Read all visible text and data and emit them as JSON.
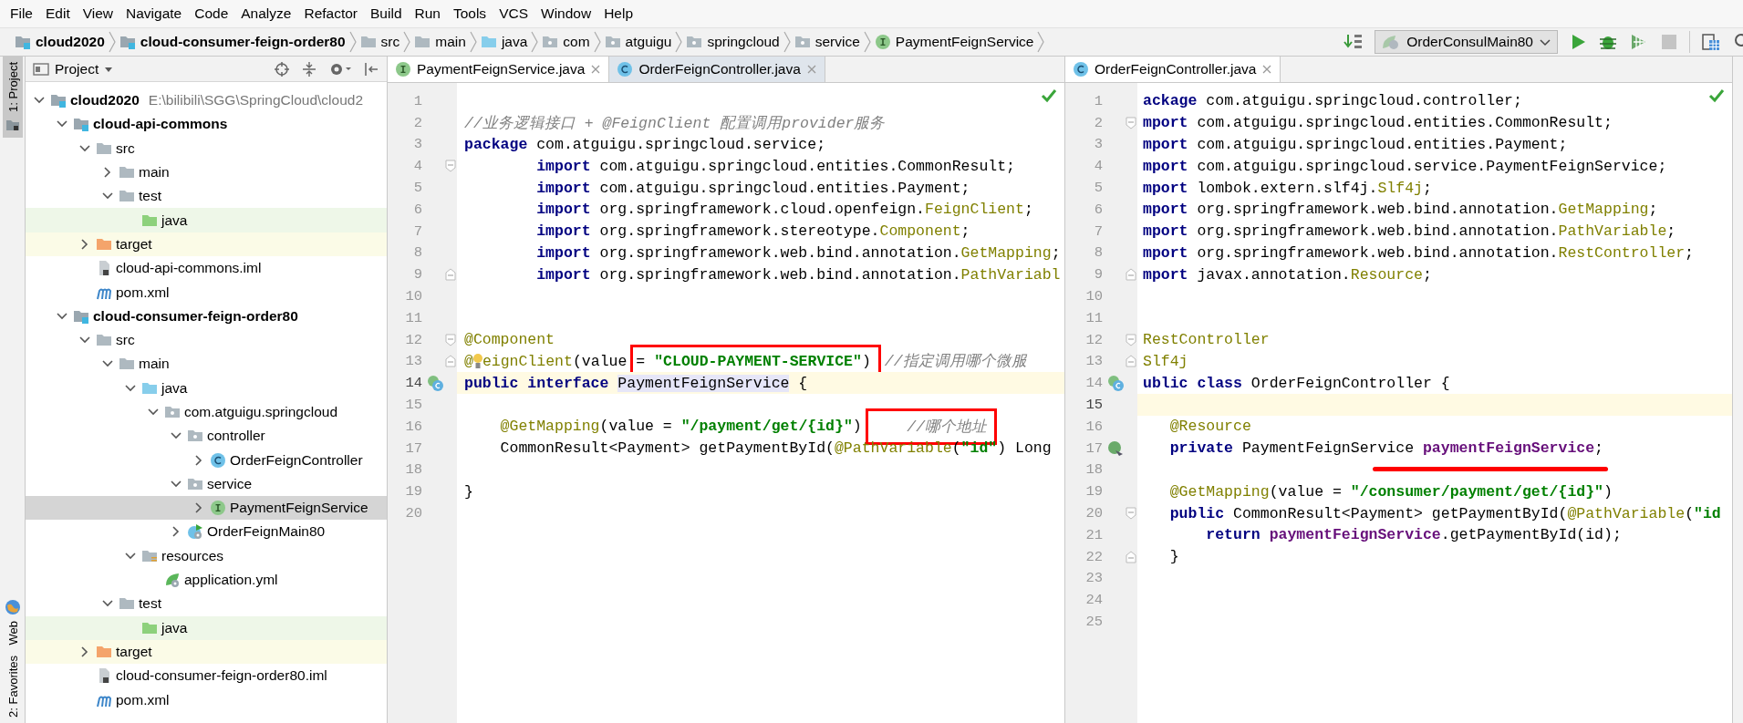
{
  "menu": [
    {
      "label": "File"
    },
    {
      "label": "Edit"
    },
    {
      "label": "View"
    },
    {
      "label": "Navigate"
    },
    {
      "label": "Code"
    },
    {
      "label": "Analyze"
    },
    {
      "label": "Refactor"
    },
    {
      "label": "Build"
    },
    {
      "label": "Run"
    },
    {
      "label": "Tools"
    },
    {
      "label": "VCS"
    },
    {
      "label": "Window"
    },
    {
      "label": "Help"
    }
  ],
  "breadcrumbs": [
    {
      "label": "cloud2020",
      "kind": "module"
    },
    {
      "label": "cloud-consumer-feign-order80",
      "kind": "module"
    },
    {
      "label": "src",
      "kind": "folder"
    },
    {
      "label": "main",
      "kind": "folder"
    },
    {
      "label": "java",
      "kind": "source"
    },
    {
      "label": "com",
      "kind": "package"
    },
    {
      "label": "atguigu",
      "kind": "package"
    },
    {
      "label": "springcloud",
      "kind": "package"
    },
    {
      "label": "service",
      "kind": "package"
    },
    {
      "label": "PaymentFeignService",
      "kind": "interface"
    }
  ],
  "run_config": {
    "label": "OrderConsulMain80"
  },
  "tool_strip": [
    {
      "label": "1: Project",
      "selected": true,
      "kind": "folder"
    },
    {
      "label": "Web",
      "selected": false,
      "kind": "globe"
    },
    {
      "label": "2: Favorites",
      "selected": false
    }
  ],
  "project": {
    "title": "Project",
    "tree": [
      {
        "label": "cloud2020",
        "kind": "module",
        "path": "E:\\bilibili\\SGG\\SpringCloud\\cloud2",
        "expanded": true,
        "selected": false,
        "children": [
          {
            "label": "cloud-api-commons",
            "kind": "module",
            "expanded": true,
            "selected": false,
            "children": [
              {
                "label": "src",
                "kind": "folder",
                "expanded": true,
                "selected": false,
                "children": [
                  {
                    "label": "main",
                    "kind": "folder",
                    "expanded": false,
                    "selected": false
                  },
                  {
                    "label": "test",
                    "kind": "folder",
                    "expanded": true,
                    "selected": false,
                    "children": [
                      {
                        "label": "java",
                        "kind": "test",
                        "selected": false
                      }
                    ]
                  }
                ]
              },
              {
                "label": "target",
                "kind": "excluded",
                "expanded": false,
                "selected": false
              },
              {
                "label": "cloud-api-commons.iml",
                "kind": "iml",
                "selected": false
              },
              {
                "label": "pom.xml",
                "kind": "maven",
                "selected": false
              }
            ]
          },
          {
            "label": "cloud-consumer-feign-order80",
            "kind": "module",
            "expanded": true,
            "selected": false,
            "children": [
              {
                "label": "src",
                "kind": "folder",
                "expanded": true,
                "selected": false,
                "children": [
                  {
                    "label": "main",
                    "kind": "folder",
                    "expanded": true,
                    "selected": false,
                    "children": [
                      {
                        "label": "java",
                        "kind": "source",
                        "expanded": true,
                        "selected": false,
                        "children": [
                          {
                            "label": "com.atguigu.springcloud",
                            "kind": "package",
                            "expanded": true,
                            "selected": false,
                            "children": [
                              {
                                "label": "controller",
                                "kind": "package",
                                "expanded": true,
                                "selected": false,
                                "children": [
                                  {
                                    "label": "OrderFeignController",
                                    "kind": "class",
                                    "expanded": false,
                                    "selected": false
                                  }
                                ]
                              },
                              {
                                "label": "service",
                                "kind": "package",
                                "expanded": true,
                                "selected": false,
                                "children": [
                                  {
                                    "label": "PaymentFeignService",
                                    "kind": "interface",
                                    "expanded": false,
                                    "selected": true
                                  }
                                ]
                              },
                              {
                                "label": "OrderFeignMain80",
                                "kind": "boot",
                                "expanded": false,
                                "selected": false
                              }
                            ]
                          }
                        ]
                      },
                      {
                        "label": "resources",
                        "kind": "resources",
                        "expanded": true,
                        "selected": false,
                        "children": [
                          {
                            "label": "application.yml",
                            "kind": "yml",
                            "selected": false
                          }
                        ]
                      }
                    ]
                  },
                  {
                    "label": "test",
                    "kind": "folder",
                    "expanded": true,
                    "selected": false,
                    "children": [
                      {
                        "label": "java",
                        "kind": "test",
                        "selected": false
                      }
                    ]
                  }
                ]
              },
              {
                "label": "target",
                "kind": "excluded",
                "expanded": false,
                "selected": false
              },
              {
                "label": "cloud-consumer-feign-order80.iml",
                "kind": "iml",
                "selected": false
              },
              {
                "label": "pom.xml",
                "kind": "maven",
                "selected": false
              }
            ]
          }
        ]
      }
    ]
  },
  "editors": [
    {
      "tabs": [
        {
          "label": "PaymentFeignService.java",
          "kind": "interface",
          "selected": true
        },
        {
          "label": "OrderFeignController.java",
          "kind": "class",
          "selected": false
        }
      ],
      "lines": [
        {
          "number": "1",
          "current": false
        },
        {
          "number": "2",
          "current": false,
          "tokens": [
            {
              "kind": "comment",
              "text": "//业务逻辑接口 + @FeignClient 配置调用provider服务"
            }
          ]
        },
        {
          "number": "3",
          "current": false,
          "tokens": [
            {
              "kind": "keyword",
              "text": "package"
            },
            {
              "kind": "plain",
              "text": " com.atguigu.springcloud.service;"
            }
          ]
        },
        {
          "number": "4",
          "current": false,
          "gutter_mark": {
            "kind": "fold-open"
          },
          "tokens": [
            {
              "kind": "keyword",
              "text": "        import"
            },
            {
              "kind": "plain",
              "text": " com.atguigu.springcloud.entities.CommonResult;"
            }
          ]
        },
        {
          "number": "5",
          "current": false,
          "tokens": [
            {
              "kind": "keyword",
              "text": "        import"
            },
            {
              "kind": "plain",
              "text": " com.atguigu.springcloud.entities.Payment;"
            }
          ]
        },
        {
          "number": "6",
          "current": false,
          "tokens": [
            {
              "kind": "keyword",
              "text": "        import"
            },
            {
              "kind": "plain",
              "text": " org.springframework.cloud.openfeign."
            },
            {
              "kind": "annotation",
              "text": "FeignClient"
            },
            {
              "kind": "plain",
              "text": ";"
            }
          ]
        },
        {
          "number": "7",
          "current": false,
          "tokens": [
            {
              "kind": "keyword",
              "text": "        import"
            },
            {
              "kind": "plain",
              "text": " org.springframework.stereotype."
            },
            {
              "kind": "annotation",
              "text": "Component"
            },
            {
              "kind": "plain",
              "text": ";"
            }
          ]
        },
        {
          "number": "8",
          "current": false,
          "tokens": [
            {
              "kind": "keyword",
              "text": "        import"
            },
            {
              "kind": "plain",
              "text": " org.springframework.web.bind.annotation."
            },
            {
              "kind": "annotation",
              "text": "GetMapping"
            },
            {
              "kind": "plain",
              "text": ";"
            }
          ]
        },
        {
          "number": "9",
          "current": false,
          "gutter_mark": {
            "kind": "fold-close"
          },
          "tokens": [
            {
              "kind": "keyword",
              "text": "        import"
            },
            {
              "kind": "plain",
              "text": " org.springframework.web.bind.annotation."
            },
            {
              "kind": "annotation",
              "text": "PathVariabl"
            }
          ]
        },
        {
          "number": "10",
          "current": false
        },
        {
          "number": "11",
          "current": false
        },
        {
          "number": "12",
          "current": false,
          "gutter_mark": {
            "kind": "fold-open"
          },
          "tokens": [
            {
              "kind": "annotation",
              "text": "@Component"
            }
          ]
        },
        {
          "number": "13",
          "current": false,
          "gutter_mark": {
            "kind": "fold-close"
          },
          "tokens": [
            {
              "kind": "annotation",
              "text": "@"
            },
            {
              "kind": "bulb"
            },
            {
              "kind": "annotation",
              "text": "eignClient"
            },
            {
              "kind": "plain",
              "text": "(value"
            },
            {
              "kind": "frame",
              "tokens": [
                {
                  "kind": "plain",
                  "text": "= "
                },
                {
                  "kind": "string",
                  "text": "\"CLOUD-PAYMENT-SERVICE\""
                },
                {
                  "kind": "plain",
                  "text": ")"
                }
              ]
            },
            {
              "kind": "comment",
              "text": "//指定调用哪个微服"
            }
          ]
        },
        {
          "number": "14",
          "current": true,
          "gutter_mark": {
            "kind": "implemented"
          },
          "tokens": [
            {
              "kind": "keyword",
              "text": "public interface "
            },
            {
              "kind": "usage",
              "text": "PaymentFeignService"
            },
            {
              "kind": "plain",
              "text": " {"
            }
          ]
        },
        {
          "number": "15",
          "current": false
        },
        {
          "number": "16",
          "current": false,
          "tokens": [
            {
              "kind": "annotation",
              "text": "    @GetMapping"
            },
            {
              "kind": "plain",
              "text": "(value = "
            },
            {
              "kind": "string",
              "text": "\"/payment/get/{id}\""
            },
            {
              "kind": "plain",
              "text": ")"
            },
            {
              "kind": "frame",
              "tokens": [
                {
                  "kind": "comment",
                  "text": "    //哪个地址"
                }
              ]
            }
          ]
        },
        {
          "number": "17",
          "current": false,
          "tokens": [
            {
              "kind": "plain",
              "text": "    CommonResult<Payment> getPaymentById("
            },
            {
              "kind": "annotation",
              "text": "@PathVariable"
            },
            {
              "kind": "plain",
              "text": "("
            },
            {
              "kind": "string",
              "text": "\"id\""
            },
            {
              "kind": "plain",
              "text": ") Long"
            }
          ]
        },
        {
          "number": "18",
          "current": false
        },
        {
          "number": "19",
          "current": false,
          "tokens": [
            {
              "kind": "plain",
              "text": "}"
            }
          ]
        },
        {
          "number": "20",
          "current": false
        }
      ]
    },
    {
      "tabs": [
        {
          "label": "OrderFeignController.java",
          "kind": "class",
          "selected": true
        }
      ],
      "lines": [
        {
          "number": "1",
          "current": false,
          "tokens": [
            {
              "kind": "keyword",
              "text": "ackage"
            },
            {
              "kind": "plain",
              "text": " com.atguigu.springcloud.controller;"
            }
          ]
        },
        {
          "number": "2",
          "current": false,
          "gutter_mark": {
            "kind": "fold-open"
          },
          "tokens": [
            {
              "kind": "keyword",
              "text": "mport"
            },
            {
              "kind": "plain",
              "text": " com.atguigu.springcloud.entities.CommonResult;"
            }
          ]
        },
        {
          "number": "3",
          "current": false,
          "tokens": [
            {
              "kind": "keyword",
              "text": "mport"
            },
            {
              "kind": "plain",
              "text": " com.atguigu.springcloud.entities.Payment;"
            }
          ]
        },
        {
          "number": "4",
          "current": false,
          "tokens": [
            {
              "kind": "keyword",
              "text": "mport"
            },
            {
              "kind": "plain",
              "text": " com.atguigu.springcloud.service.PaymentFeignService;"
            }
          ]
        },
        {
          "number": "5",
          "current": false,
          "tokens": [
            {
              "kind": "keyword",
              "text": "mport"
            },
            {
              "kind": "plain",
              "text": " lombok.extern.slf4j."
            },
            {
              "kind": "annotation",
              "text": "Slf4j"
            },
            {
              "kind": "plain",
              "text": ";"
            }
          ]
        },
        {
          "number": "6",
          "current": false,
          "tokens": [
            {
              "kind": "keyword",
              "text": "mport"
            },
            {
              "kind": "plain",
              "text": " org.springframework.web.bind.annotation."
            },
            {
              "kind": "annotation",
              "text": "GetMapping"
            },
            {
              "kind": "plain",
              "text": ";"
            }
          ]
        },
        {
          "number": "7",
          "current": false,
          "tokens": [
            {
              "kind": "keyword",
              "text": "mport"
            },
            {
              "kind": "plain",
              "text": " org.springframework.web.bind.annotation."
            },
            {
              "kind": "annotation",
              "text": "PathVariable"
            },
            {
              "kind": "plain",
              "text": ";"
            }
          ]
        },
        {
          "number": "8",
          "current": false,
          "tokens": [
            {
              "kind": "keyword",
              "text": "mport"
            },
            {
              "kind": "plain",
              "text": " org.springframework.web.bind.annotation."
            },
            {
              "kind": "annotation",
              "text": "RestController"
            },
            {
              "kind": "plain",
              "text": ";"
            }
          ]
        },
        {
          "number": "9",
          "current": false,
          "gutter_mark": {
            "kind": "fold-close"
          },
          "tokens": [
            {
              "kind": "keyword",
              "text": "mport"
            },
            {
              "kind": "plain",
              "text": " javax.annotation."
            },
            {
              "kind": "annotation",
              "text": "Resource"
            },
            {
              "kind": "plain",
              "text": ";"
            }
          ]
        },
        {
          "number": "10",
          "current": false
        },
        {
          "number": "11",
          "current": false
        },
        {
          "number": "12",
          "current": false,
          "gutter_mark": {
            "kind": "fold-open"
          },
          "tokens": [
            {
              "kind": "annotation",
              "text": "RestController"
            }
          ]
        },
        {
          "number": "13",
          "current": false,
          "gutter_mark": {
            "kind": "fold-close"
          },
          "tokens": [
            {
              "kind": "annotation",
              "text": "Slf4j"
            }
          ]
        },
        {
          "number": "14",
          "current": false,
          "gutter_mark": {
            "kind": "implemented"
          },
          "tokens": [
            {
              "kind": "keyword",
              "text": "ublic class"
            },
            {
              "kind": "plain",
              "text": " OrderFeignController {"
            }
          ]
        },
        {
          "number": "15",
          "current": true
        },
        {
          "number": "16",
          "current": false,
          "tokens": [
            {
              "kind": "annotation",
              "text": "   @Resource"
            }
          ]
        },
        {
          "number": "17",
          "current": false,
          "gutter_mark": {
            "kind": "injected"
          },
          "tokens": [
            {
              "kind": "keyword",
              "text": "   private"
            },
            {
              "kind": "plain",
              "text": " PaymentFeignService "
            },
            {
              "kind": "underline",
              "tokens": [
                {
                  "kind": "field",
                  "text": "paymentFeignService"
                }
              ]
            },
            {
              "kind": "plain",
              "text": ";"
            }
          ]
        },
        {
          "number": "18",
          "current": false
        },
        {
          "number": "19",
          "current": false,
          "tokens": [
            {
              "kind": "annotation",
              "text": "   @GetMapping"
            },
            {
              "kind": "plain",
              "text": "(value = "
            },
            {
              "kind": "string",
              "text": "\"/consumer/payment/get/{id}\""
            },
            {
              "kind": "plain",
              "text": ")"
            }
          ]
        },
        {
          "number": "20",
          "current": false,
          "gutter_mark": {
            "kind": "fold-open"
          },
          "tokens": [
            {
              "kind": "keyword",
              "text": "   public"
            },
            {
              "kind": "plain",
              "text": " CommonResult<Payment> getPaymentById("
            },
            {
              "kind": "annotation",
              "text": "@PathVariable"
            },
            {
              "kind": "plain",
              "text": "("
            },
            {
              "kind": "string",
              "text": "\"id"
            }
          ]
        },
        {
          "number": "21",
          "current": false,
          "tokens": [
            {
              "kind": "keyword",
              "text": "       return "
            },
            {
              "kind": "field",
              "text": "paymentFeignService"
            },
            {
              "kind": "plain",
              "text": ".getPaymentById(id);"
            }
          ]
        },
        {
          "number": "22",
          "current": false,
          "gutter_mark": {
            "kind": "fold-close"
          },
          "tokens": [
            {
              "kind": "plain",
              "text": "   }"
            }
          ]
        },
        {
          "number": "23",
          "current": false
        },
        {
          "number": "24",
          "current": false
        },
        {
          "number": "25",
          "current": false
        }
      ]
    }
  ]
}
